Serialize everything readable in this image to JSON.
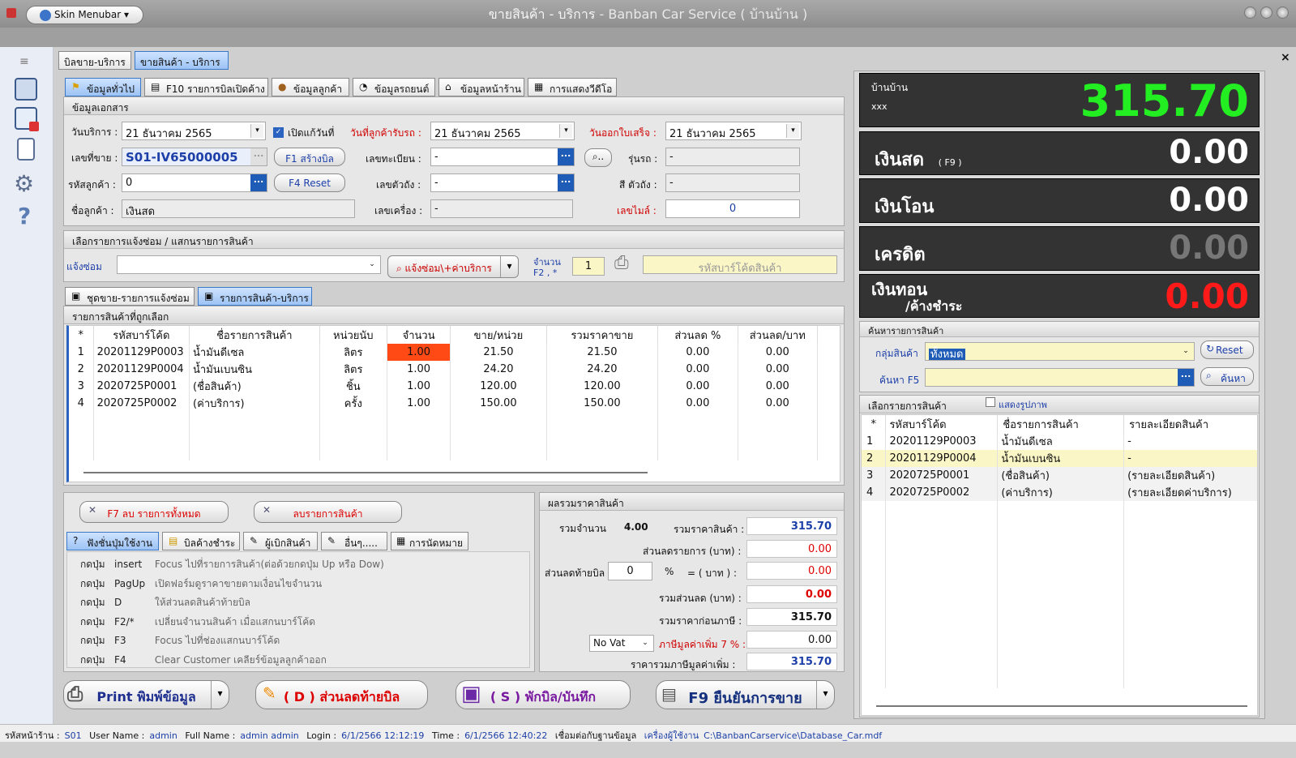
{
  "window": {
    "title": "ขายสินค้า - บริการ",
    "subtitle": " - Banban Car Service  ( บ้านบ้าน )",
    "skin_menu": "Skin Menubar"
  },
  "main_tabs": [
    "บิลขาย-บริการ",
    "ขายสินค้า - บริการ"
  ],
  "info_tabs": [
    "ข้อมูลทั่วไป",
    "F10 รายการบิลเปิดค้าง",
    "ข้อมูลลูกค้า",
    "ข้อมูลรถยนต์",
    "ข้อมูลหน้าร้าน",
    "การแสดงวีดีโอ"
  ],
  "doc": {
    "header": "ข้อมูลเอกสาร",
    "service_date_label": "วันบริการ :",
    "service_date": "21    ธันวาคม     2565",
    "fix_today_label": "เปิดแก้วันที่",
    "receive_date_label": "วันที่ลูกค้ารับรถ :",
    "receive_date": "21    ธันวาคม     2565",
    "invoice_date_label": "วันออกใบเสร็จ :",
    "invoice_date": "21    ธันวาคม     2565",
    "sale_no_label": "เลขที่ขาย :",
    "sale_no": "S01-IV65000005",
    "create_bill_btn": "F1 สร้างบิล",
    "plate_label": "เลขทะเบียน :",
    "plate": "-",
    "model_label": "รุ่นรถ :",
    "model": "-",
    "customer_code_label": "รหัสลูกค้า :",
    "customer_code": "0",
    "reset_btn": "F4 Reset",
    "chassis_label": "เลขตัวถัง :",
    "chassis": "-",
    "color_label": "สี ตัวถัง :",
    "color": "-",
    "customer_name_label": "ชื่อลูกค้า :",
    "customer_name": "เงินสด",
    "engine_label": "เลขเครื่อง :",
    "engine": "-",
    "mileage_label": "เลขไมล์ :",
    "mileage": "0"
  },
  "scan": {
    "header": "เลือกรายการแจ้งซ่อม / แสกนรายการสินค้า",
    "repair_label": "แจ้งซ่อม",
    "repair_value": "",
    "repair_btn": "แจ้งซ่อม\\+ค่าบริการ",
    "qty_label1": "จำนวน",
    "qty_label2": "F2 , *",
    "qty": "1",
    "barcode_placeholder": "รหัสบาร์โค้ดสินค้า"
  },
  "sub_tabs": [
    "ชุดขาย-รายการแจ้งซ่อม",
    "รายการสินค้า-บริการ"
  ],
  "items": {
    "header": "รายการสินค้าที่ถูกเลือก",
    "columns": [
      "*",
      "รหัสบาร์โค้ด",
      "ชื่อรายการสินค้า",
      "หน่วยนับ",
      "จำนวน",
      "ขาย/หน่วย",
      "รวมราคาขาย",
      "ส่วนลด %",
      "ส่วนลด/บาท"
    ],
    "rows": [
      [
        "1",
        "20201129P0003",
        "น้ำมันดีเซล",
        "ลิตร",
        "1.00",
        "21.50",
        "21.50",
        "0.00",
        "0.00"
      ],
      [
        "2",
        "20201129P0004",
        "น้ำมันเบนซิน",
        "ลิตร",
        "1.00",
        "24.20",
        "24.20",
        "0.00",
        "0.00"
      ],
      [
        "3",
        "2020725P0001",
        "(ชื่อสินค้า)",
        "ชิ้น",
        "1.00",
        "120.00",
        "120.00",
        "0.00",
        "0.00"
      ],
      [
        "4",
        "2020725P0002",
        "(ค่าบริการ)",
        "ครั้ง",
        "1.00",
        "150.00",
        "150.00",
        "0.00",
        "0.00"
      ]
    ]
  },
  "actions": {
    "delete_all": "F7 ลบ รายการทั้งหมด",
    "delete_item": "ลบรายการสินค้า"
  },
  "bottom_tabs": [
    "ฟังชั่นปุ่มใช้งาน",
    "บิลค้างชำระ",
    "ผู้เบิกสินค้า",
    "อื่นๆ.....",
    "การนัดหมาย"
  ],
  "hotkeys": [
    {
      "pre": "กดปุ่ม",
      "key": "insert",
      "desc": "Focus ไปที่รายการสินค้า(ต่อด้วยกดปุ่ม Up หรือ Dow)"
    },
    {
      "pre": "กดปุ่ม",
      "key": "PagUp",
      "desc": "เปิดฟอร์มดูราคาขายตามเงื่อนไขจำนวน"
    },
    {
      "pre": "กดปุ่ม",
      "key": "D",
      "desc": "ให้ส่วนลดสินค้าท้ายบิล"
    },
    {
      "pre": "กดปุ่ม",
      "key": "F2/*",
      "desc": "เปลี่ยนจำนวนสินค้า เมื่อแสกนบาร์โค้ด"
    },
    {
      "pre": "กดปุ่ม",
      "key": "F3",
      "desc": "Focus ไปที่ช่องแสกนบาร์โค้ด"
    },
    {
      "pre": "กดปุ่ม",
      "key": "F4",
      "desc": "Clear Customer เคลียร์ข้อมูลลูกค้าออก"
    }
  ],
  "summary": {
    "header": "ผลรวมราคาสินค้า",
    "total_qty_label": "รวมจำนวน",
    "total_qty": "4.00",
    "total_price_label": "รวมราคาสินค้า :",
    "total_price": "315.70",
    "item_discount_label": "ส่วนลดรายการ (บาท) :",
    "item_discount": "0.00",
    "bill_discount_label": "ส่วนลดท้ายบิล",
    "bill_discount_pct": "0",
    "pct_sign": "%",
    "eq_label": "=  ( บาท ) :",
    "bill_discount": "0.00",
    "total_discount_label": "รวมส่วนลด (บาท) :",
    "total_discount": "0.00",
    "before_vat_label": "รวมราคาก่อนภาษี :",
    "before_vat": "315.70",
    "vat_mode": "No Vat",
    "vat_label": "ภาษีมูลค่าเพิ่ม 7 % :",
    "vat": "0.00",
    "grand_label": "ราคารวมภาษีมูลค่าเพิ่ม :",
    "grand": "315.70"
  },
  "bottom_buttons": {
    "print": "Print พิมพ์ข้อมูล",
    "discount": "( D ) ส่วนลดท้ายบิล",
    "hold": "( S ) พักบิล/บันทึก",
    "confirm": "F9 ยืนยันการขาย"
  },
  "display": {
    "shop": "บ้านบ้าน",
    "sub": "xxx",
    "total": "315.70",
    "cash_label": "เงินสด",
    "cash_key": "( F9 )",
    "cash": "0.00",
    "transfer_label": "เงินโอน",
    "transfer": "0.00",
    "credit_label": "เครดิต",
    "credit": "0.00",
    "change_label1": "เงินทอน",
    "change_label2": "/ค้างชำระ",
    "change": "0.00"
  },
  "search": {
    "header": "ค้นหารายการสินค้า",
    "group_label": "กลุ่มสินค้า",
    "group_value": "ทั้งหมด",
    "reset_btn": "Reset",
    "find_label": "ค้นหา F5",
    "find_btn": "ค้นหา"
  },
  "product_list": {
    "header": "เลือกรายการสินค้า",
    "show_image": "แสดงรูปภาพ",
    "columns": [
      "*",
      "รหัสบาร์โค้ด",
      "ชื่อรายการสินค้า",
      "รายละเอียดสินค้า"
    ],
    "rows": [
      [
        "1",
        "20201129P0003",
        "น้ำมันดีเซล",
        "-"
      ],
      [
        "2",
        "20201129P0004",
        "น้ำมันเบนซิน",
        "-"
      ],
      [
        "3",
        "2020725P0001",
        "(ชื่อสินค้า)",
        "(รายละเอียดสินค้า)"
      ],
      [
        "4",
        "2020725P0002",
        "(ค่าบริการ)",
        "(รายละเอียดค่าบริการ)"
      ]
    ]
  },
  "status": {
    "shop_label": "รหัสหน้าร้าน :",
    "shop": "S01",
    "user_label": "User Name :",
    "user": "admin",
    "full_label": "Full Name :",
    "full": "admin admin",
    "login_label": "Login :",
    "login": "6/1/2566 12:12:19",
    "time_label": "Time :",
    "time": "6/1/2566 12:40:22",
    "db_label": "เชื่อมต่อกับฐานข้อมูล",
    "machine_label": "เครื่องผู้ใช้งาน",
    "path": "C:\\BanbanCarservice\\Database_Car.mdf"
  },
  "colors": {
    "accent": "#2a64c0",
    "green_total": "#22ee22",
    "red": "#ff1a1a",
    "qty_highlight": "#ff4a16"
  }
}
